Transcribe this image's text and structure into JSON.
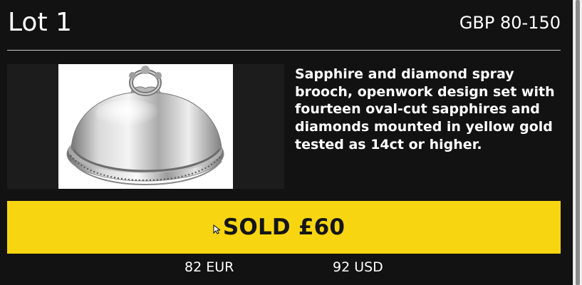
{
  "lot": {
    "title": "Lot 1",
    "estimate": "GBP 80-150",
    "description": "Sapphire and diamond spray brooch, openwork design set with fourteen oval-cut sapphires and diamonds mounted in yellow gold tested as 14ct or higher.",
    "image_icon": "silver-serving-dome-icon"
  },
  "result": {
    "sold_label": "SOLD £60",
    "conversion_eur": "82 EUR",
    "conversion_usd": "92 USD"
  },
  "colors": {
    "background": "#121212",
    "accent": "#f7d611",
    "text": "#ffffff",
    "divider": "#c9c9c9"
  }
}
